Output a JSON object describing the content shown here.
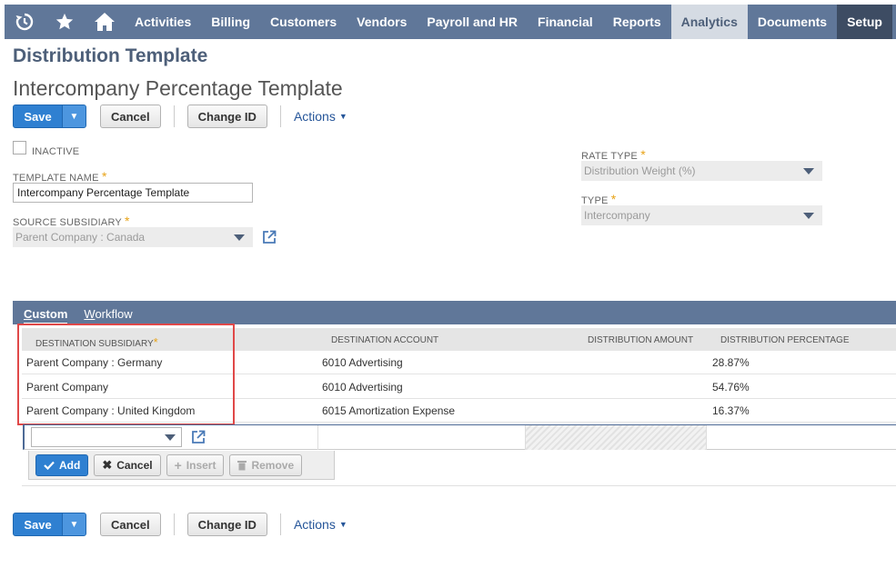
{
  "nav": {
    "items": [
      {
        "label": "Activities"
      },
      {
        "label": "Billing"
      },
      {
        "label": "Customers"
      },
      {
        "label": "Vendors"
      },
      {
        "label": "Payroll and HR"
      },
      {
        "label": "Financial"
      },
      {
        "label": "Reports"
      },
      {
        "label": "Analytics"
      },
      {
        "label": "Documents"
      },
      {
        "label": "Setup"
      }
    ],
    "active": "Analytics",
    "icons": [
      "recent-icon",
      "star-icon",
      "home-icon"
    ]
  },
  "page": {
    "title": "Distribution Template",
    "record_name": "Intercompany Percentage Template"
  },
  "toolbar": {
    "save_label": "Save",
    "cancel_label": "Cancel",
    "change_id_label": "Change ID",
    "actions_label": "Actions"
  },
  "form": {
    "inactive_label": "INACTIVE",
    "inactive_checked": false,
    "template_name_label": "TEMPLATE NAME",
    "template_name_value": "Intercompany Percentage Template",
    "source_subsidiary_label": "SOURCE SUBSIDIARY",
    "source_subsidiary_value": "Parent Company : Canada",
    "rate_type_label": "RATE TYPE",
    "rate_type_value": "Distribution Weight (%)",
    "type_label": "TYPE",
    "type_value": "Intercompany",
    "required_mark": "*"
  },
  "sublist": {
    "tabs": [
      {
        "label_first": "C",
        "label_rest": "ustom"
      },
      {
        "label_first": "W",
        "label_rest": "orkflow"
      }
    ],
    "columns": [
      "DESTINATION SUBSIDIARY",
      "DESTINATION ACCOUNT",
      "DISTRIBUTION AMOUNT",
      "DISTRIBUTION PERCENTAGE"
    ],
    "rows": [
      {
        "subsidiary": "Parent Company : Germany",
        "account": "6010 Advertising",
        "amount": "",
        "percentage": "28.87%"
      },
      {
        "subsidiary": "Parent Company",
        "account": "6010 Advertising",
        "amount": "",
        "percentage": "54.76%"
      },
      {
        "subsidiary": "Parent Company : United Kingdom",
        "account": "6015 Amortization Expense",
        "amount": "",
        "percentage": "16.37%"
      }
    ],
    "row_buttons": {
      "add": "Add",
      "cancel": "Cancel",
      "insert": "Insert",
      "remove": "Remove"
    }
  },
  "colors": {
    "nav_bg": "#607799",
    "active_tab_bg": "#d5dbe3",
    "primary_button": "#2f80d1",
    "heading": "#4d5f79",
    "highlight_box": "#e04848",
    "required": "#e8a317"
  }
}
